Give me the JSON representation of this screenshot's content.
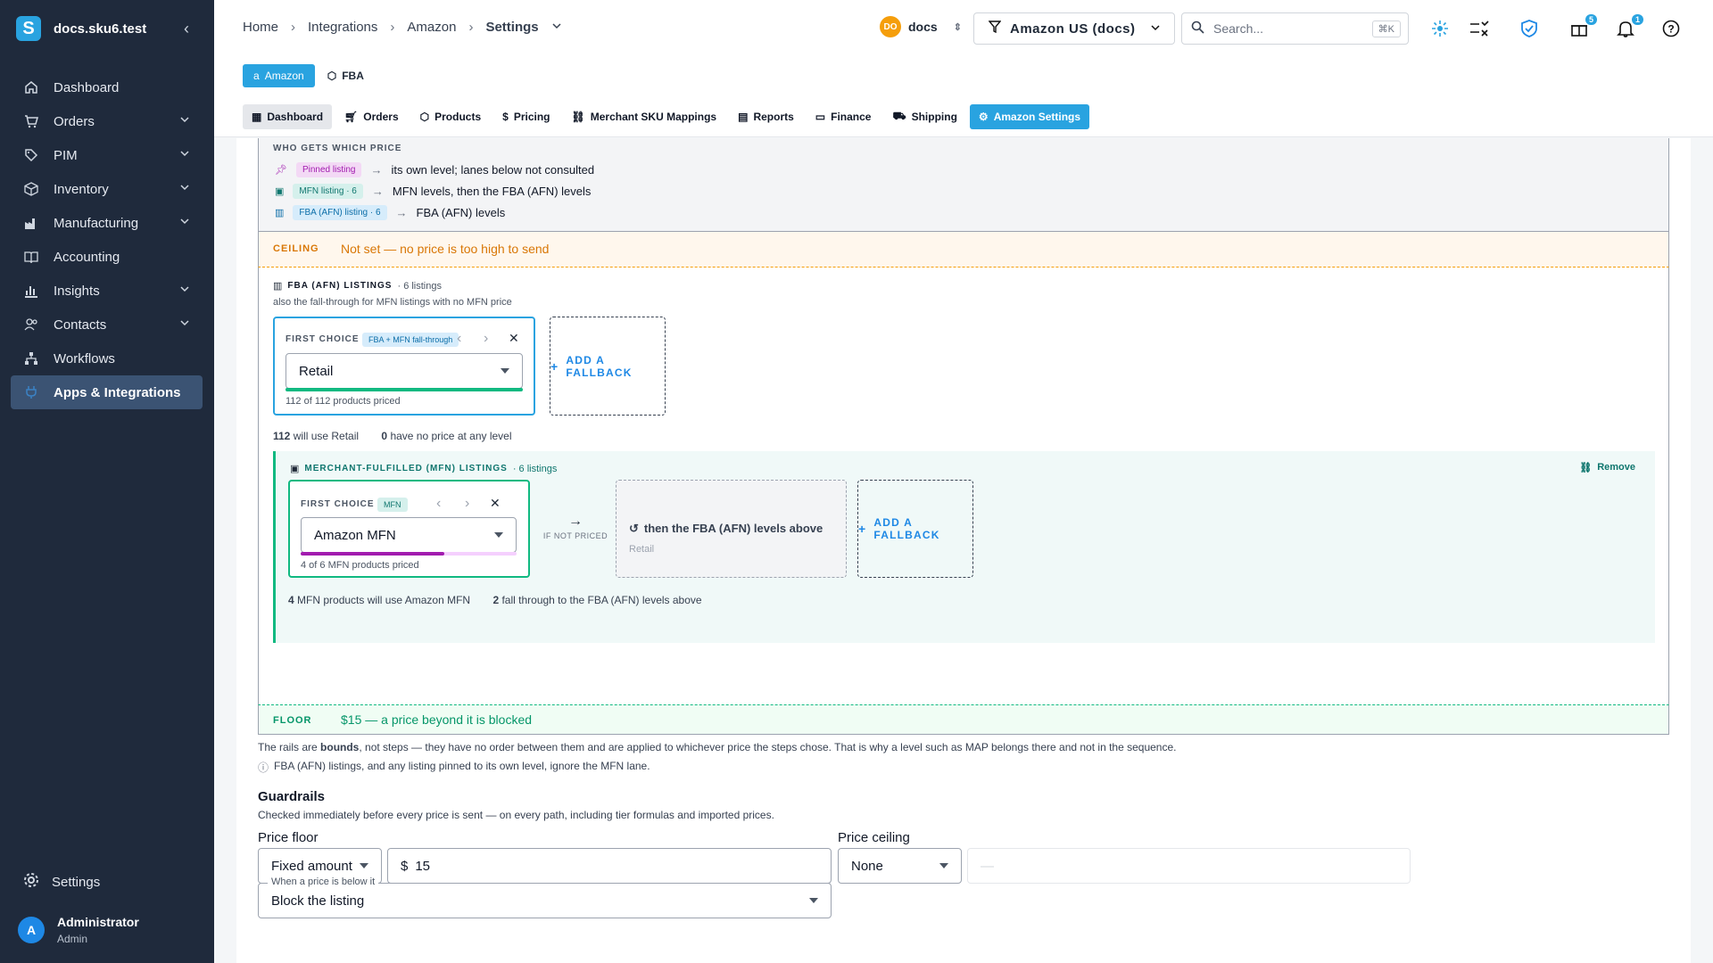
{
  "sidebar": {
    "brand": "docs.sku6.test",
    "items": [
      {
        "label": "Dashboard"
      },
      {
        "label": "Orders"
      },
      {
        "label": "PIM"
      },
      {
        "label": "Inventory"
      },
      {
        "label": "Manufacturing"
      },
      {
        "label": "Accounting"
      },
      {
        "label": "Insights"
      },
      {
        "label": "Contacts"
      },
      {
        "label": "Workflows"
      },
      {
        "label": "Apps & Integrations"
      }
    ],
    "settings": "Settings",
    "user": {
      "initial": "A",
      "name": "Administrator",
      "role": "Admin"
    }
  },
  "header": {
    "breadcrumbs": [
      "Home",
      "Integrations",
      "Amazon",
      "Settings"
    ],
    "account": {
      "initials": "DO",
      "name": "docs"
    },
    "store": "Amazon US (docs)",
    "search": {
      "placeholder": "Search...",
      "shortcut": "⌘K"
    },
    "badges": {
      "gifts": "5",
      "notifications": "1"
    }
  },
  "channels": {
    "primary": "Amazon",
    "secondary": "FBA"
  },
  "tabs": [
    "Dashboard",
    "Orders",
    "Products",
    "Pricing",
    "Merchant SKU Mappings",
    "Reports",
    "Finance",
    "Shipping",
    "Amazon Settings"
  ],
  "who": {
    "heading": "WHO GETS WHICH PRICE",
    "rows": [
      {
        "pill": "Pinned listing",
        "text": "its own level; lanes below not consulted"
      },
      {
        "pill": "MFN listing · 6",
        "text": "MFN levels, then the FBA (AFN) levels"
      },
      {
        "pill": "FBA (AFN) listing · 6",
        "text": "FBA (AFN) levels"
      }
    ]
  },
  "ceiling": {
    "tag": "CEILING",
    "text": "Not set — no price is too high to send"
  },
  "fba": {
    "heading": "FBA (AFN) LISTINGS",
    "count": "· 6 listings",
    "sub": "also the fall-through for MFN listings with no MFN price",
    "first_choice": "FIRST CHOICE",
    "pill": "FBA + MFN fall-through",
    "select": "Retail",
    "priced": "112 of 112 products priced",
    "progress": 1.0,
    "fallback": "ADD A FALLBACK",
    "summary_a_num": "112",
    "summary_a_text": "will use Retail",
    "summary_b_num": "0",
    "summary_b_text": "have no price at any level"
  },
  "mfn": {
    "heading": "MERCHANT-FULFILLED (MFN) LISTINGS",
    "count": "· 6 listings",
    "remove": "Remove",
    "first_choice": "FIRST CHOICE",
    "pill": "MFN",
    "select": "Amazon MFN",
    "priced": "4 of 6 MFN products priced",
    "progress": 0.667,
    "if_not": "IF NOT PRICED",
    "then": "then the FBA (AFN) levels above",
    "then_sub": "Retail",
    "fallback": "ADD A FALLBACK",
    "summary_a_num": "4",
    "summary_a_text": "MFN products will use Amazon MFN",
    "summary_b_num": "2",
    "summary_b_text": "fall through to the FBA (AFN) levels above"
  },
  "floor": {
    "tag": "FLOOR",
    "text": "$15 — a price beyond it is blocked"
  },
  "notes": {
    "rails_a": "The rails are ",
    "rails_bold": "bounds",
    "rails_b": ", not steps — they have no order between them and are applied to whichever price the steps chose. That is why a level such as MAP belongs there and not in the sequence.",
    "info": "FBA (AFN) listings, and any listing pinned to its own level, ignore the MFN lane."
  },
  "guardrails": {
    "title": "Guardrails",
    "desc": "Checked immediately before every price is sent — on every path, including tier formulas and imported prices.",
    "floor_label": "Price floor",
    "floor_type": "Fixed amount",
    "currency": "$",
    "floor_value": "15",
    "below_legend": "When a price is below it",
    "below_action": "Block the listing",
    "ceiling_label": "Price ceiling",
    "ceiling_type": "None",
    "ceiling_value": "—"
  }
}
